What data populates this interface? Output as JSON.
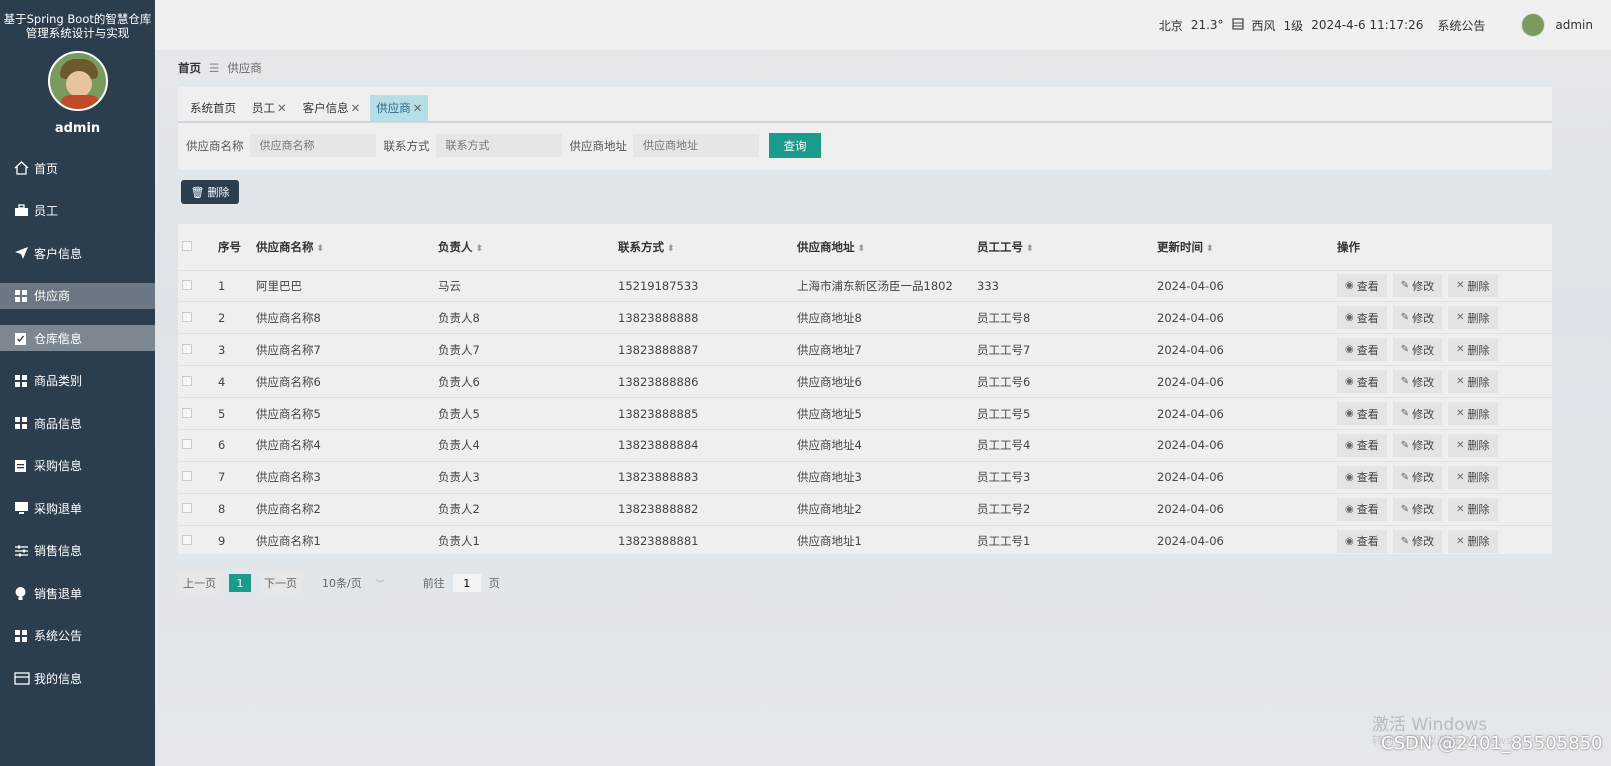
{
  "app": {
    "title": "基于Spring Boot的智慧仓库管理系统设计与实现"
  },
  "sidebar": {
    "username": "admin",
    "items": [
      {
        "label": "首页",
        "icon": "home-icon"
      },
      {
        "label": "员工",
        "icon": "briefcase-icon"
      },
      {
        "label": "客户信息",
        "icon": "send-icon"
      },
      {
        "label": "供应商",
        "icon": "grid-icon"
      },
      {
        "label": "仓库信息",
        "icon": "clipboard-check-icon"
      },
      {
        "label": "商品类别",
        "icon": "grid-icon"
      },
      {
        "label": "商品信息",
        "icon": "grid-icon"
      },
      {
        "label": "采购信息",
        "icon": "clipboard-icon"
      },
      {
        "label": "采购退单",
        "icon": "monitor-icon"
      },
      {
        "label": "销售信息",
        "icon": "sliders-icon"
      },
      {
        "label": "销售退单",
        "icon": "bulb-icon"
      },
      {
        "label": "系统公告",
        "icon": "grid-icon"
      },
      {
        "label": "我的信息",
        "icon": "card-icon"
      }
    ]
  },
  "topbar": {
    "city": "北京",
    "temperature": "21.3°",
    "wind_dir": "西风",
    "wind_level": "1级",
    "datetime": "2024-4-6 11:17:26",
    "notice": "系统公告",
    "username": "admin"
  },
  "breadcrumb": {
    "home": "首页",
    "current": "供应商"
  },
  "tabs": [
    {
      "label": "系统首页",
      "closable": false
    },
    {
      "label": "员工",
      "closable": true
    },
    {
      "label": "客户信息",
      "closable": true
    },
    {
      "label": "供应商",
      "closable": true
    }
  ],
  "close_glyph": "✕",
  "search": {
    "name_label": "供应商名称",
    "name_placeholder": "供应商名称",
    "contact_label": "联系方式",
    "contact_placeholder": "联系方式",
    "address_label": "供应商地址",
    "address_placeholder": "供应商地址",
    "button": "查询"
  },
  "bulk_delete": "删除",
  "table": {
    "headers": [
      "序号",
      "供应商名称",
      "负责人",
      "联系方式",
      "供应商地址",
      "员工工号",
      "更新时间",
      "操作"
    ],
    "rows": [
      [
        "1",
        "阿里巴巴",
        "马云",
        "15219187533",
        "上海市浦东新区汤臣一品1802",
        "333",
        "2024-04-06"
      ],
      [
        "2",
        "供应商名称8",
        "负责人8",
        "13823888888",
        "供应商地址8",
        "员工工号8",
        "2024-04-06"
      ],
      [
        "3",
        "供应商名称7",
        "负责人7",
        "13823888887",
        "供应商地址7",
        "员工工号7",
        "2024-04-06"
      ],
      [
        "4",
        "供应商名称6",
        "负责人6",
        "13823888886",
        "供应商地址6",
        "员工工号6",
        "2024-04-06"
      ],
      [
        "5",
        "供应商名称5",
        "负责人5",
        "13823888885",
        "供应商地址5",
        "员工工号5",
        "2024-04-06"
      ],
      [
        "6",
        "供应商名称4",
        "负责人4",
        "13823888884",
        "供应商地址4",
        "员工工号4",
        "2024-04-06"
      ],
      [
        "7",
        "供应商名称3",
        "负责人3",
        "13823888883",
        "供应商地址3",
        "员工工号3",
        "2024-04-06"
      ],
      [
        "8",
        "供应商名称2",
        "负责人2",
        "13823888882",
        "供应商地址2",
        "员工工号2",
        "2024-04-06"
      ],
      [
        "9",
        "供应商名称1",
        "负责人1",
        "13823888881",
        "供应商地址1",
        "员工工号1",
        "2024-04-06"
      ]
    ],
    "actions": {
      "view": "查看",
      "edit": "修改",
      "delete": "删除"
    }
  },
  "pagination": {
    "prev": "上一页",
    "current": "1",
    "next": "下一页",
    "page_size": "10条/页",
    "goto_label": "前往",
    "goto_value": "1",
    "goto_suffix": "页"
  },
  "watermark": {
    "line1": "激活 Windows",
    "line2": "转到\"设置\"以激活 Windows。",
    "csdn": "CSDN @2401_85505850"
  },
  "colors": {
    "sidebar": "#2c3e4e",
    "accent": "#1a9b8c",
    "active_tab": "#b7dde7"
  }
}
